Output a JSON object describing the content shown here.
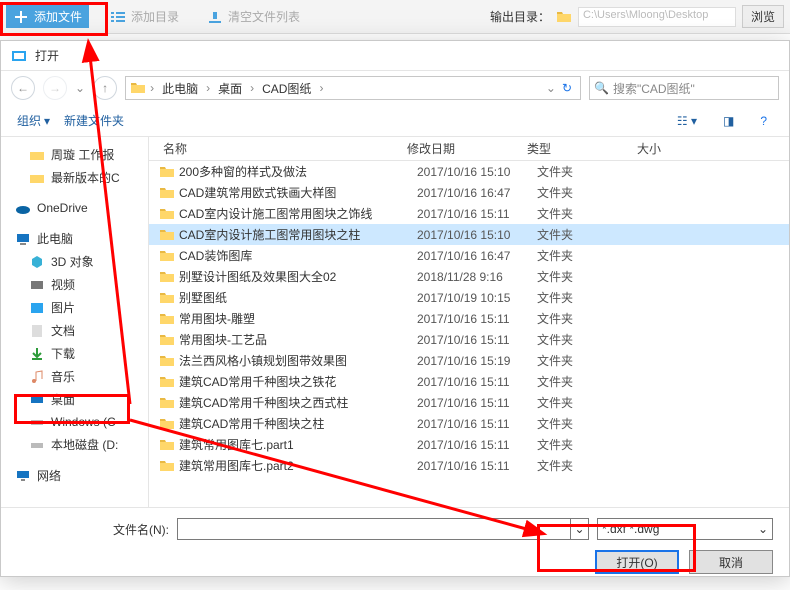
{
  "appbar": {
    "add_file": "添加文件",
    "add_dir": "添加目录",
    "clear_list": "清空文件列表",
    "output_label": "输出目录：",
    "output_path": "C:\\Users\\Mloong\\Desktop",
    "browse": "浏览"
  },
  "dialog": {
    "title": "打开",
    "breadcrumbs": [
      "此电脑",
      "桌面",
      "CAD图纸"
    ],
    "search_placeholder": "搜索\"CAD图纸\"",
    "toolbar": {
      "organize": "组织",
      "new_folder": "新建文件夹"
    },
    "sidebar": {
      "quick": [
        {
          "name": "周璇  工作报",
          "ic": "folder"
        },
        {
          "name": "最新版本的C",
          "ic": "folder"
        }
      ],
      "groups": [
        {
          "name": "OneDrive",
          "ic": "onedrive"
        },
        {
          "name": "此电脑",
          "ic": "pc",
          "children": [
            {
              "name": "3D 对象",
              "ic": "3d"
            },
            {
              "name": "视频",
              "ic": "video"
            },
            {
              "name": "图片",
              "ic": "pic"
            },
            {
              "name": "文档",
              "ic": "doc"
            },
            {
              "name": "下载",
              "ic": "dl"
            },
            {
              "name": "音乐",
              "ic": "music"
            },
            {
              "name": "桌面",
              "ic": "desktop",
              "selected": true
            },
            {
              "name": "Windows (C",
              "ic": "disk"
            },
            {
              "name": "本地磁盘 (D:",
              "ic": "disk"
            }
          ]
        },
        {
          "name": "网络",
          "ic": "net"
        }
      ]
    },
    "columns": {
      "name": "名称",
      "date": "修改日期",
      "type": "类型",
      "size": "大小"
    },
    "files": [
      {
        "name": "200多种窗的样式及做法",
        "date": "2017/10/16 15:10",
        "type": "文件夹"
      },
      {
        "name": "CAD建筑常用欧式铁画大样图",
        "date": "2017/10/16 16:47",
        "type": "文件夹"
      },
      {
        "name": "CAD室内设计施工图常用图块之饰线",
        "date": "2017/10/16 15:11",
        "type": "文件夹"
      },
      {
        "name": "CAD室内设计施工图常用图块之柱",
        "date": "2017/10/16 15:10",
        "type": "文件夹",
        "selected": true
      },
      {
        "name": "CAD装饰图库",
        "date": "2017/10/16 16:47",
        "type": "文件夹"
      },
      {
        "name": "别墅设计图纸及效果图大全02",
        "date": "2018/11/28 9:16",
        "type": "文件夹"
      },
      {
        "name": "别墅图纸",
        "date": "2017/10/19 10:15",
        "type": "文件夹"
      },
      {
        "name": "常用图块-雕塑",
        "date": "2017/10/16 15:11",
        "type": "文件夹"
      },
      {
        "name": "常用图块-工艺品",
        "date": "2017/10/16 15:11",
        "type": "文件夹"
      },
      {
        "name": "法兰西风格小镇规划图带效果图",
        "date": "2017/10/16 15:19",
        "type": "文件夹"
      },
      {
        "name": "建筑CAD常用千种图块之铁花",
        "date": "2017/10/16 15:11",
        "type": "文件夹"
      },
      {
        "name": "建筑CAD常用千种图块之西式柱",
        "date": "2017/10/16 15:11",
        "type": "文件夹"
      },
      {
        "name": "建筑CAD常用千种图块之柱",
        "date": "2017/10/16 15:11",
        "type": "文件夹"
      },
      {
        "name": "建筑常用图库七.part1",
        "date": "2017/10/16 15:11",
        "type": "文件夹"
      },
      {
        "name": "建筑常用图库七.part2",
        "date": "2017/10/16 15:11",
        "type": "文件夹"
      }
    ],
    "filename_label": "文件名(N):",
    "filter": "*.dxf *.dwg",
    "open_btn": "打开(O)",
    "cancel_btn": "取消"
  }
}
